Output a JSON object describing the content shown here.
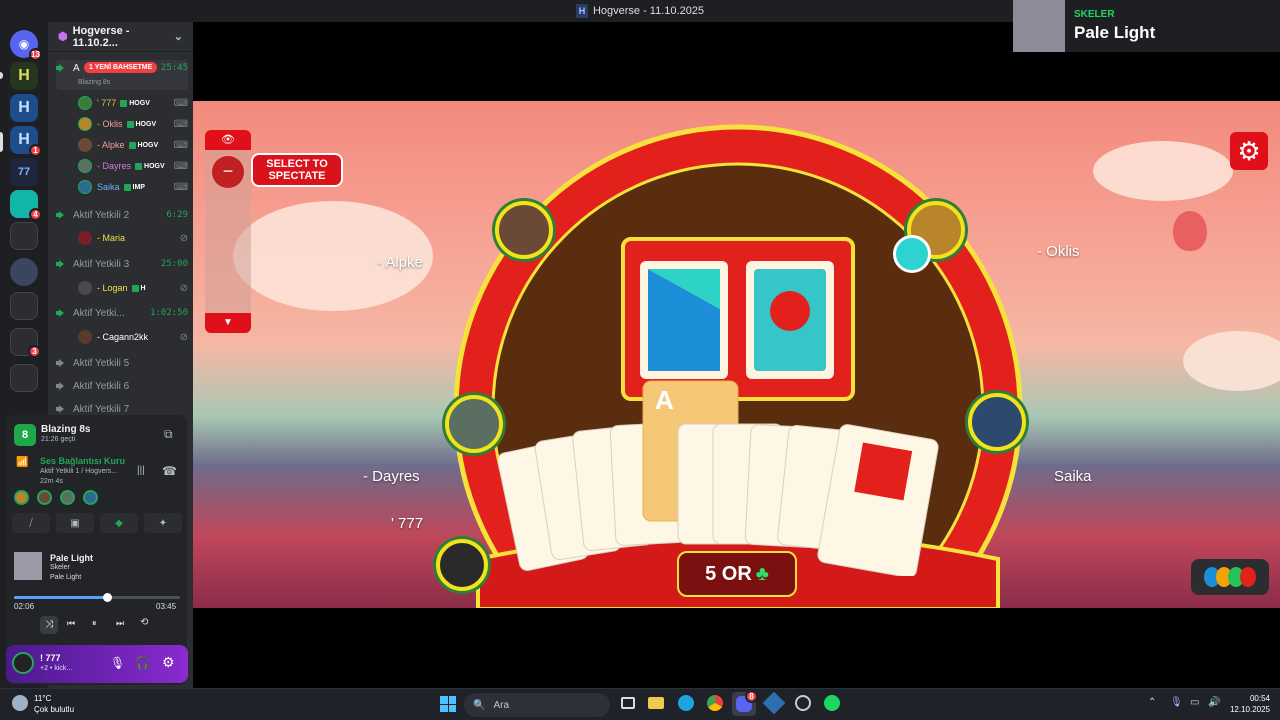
{
  "window": {
    "title": "Hogverse - 11.10.2025"
  },
  "rail": {
    "badges": [
      "13",
      "1",
      "4",
      "3"
    ]
  },
  "server": {
    "name": "Hogverse - 11.10.2...",
    "mention_badge": "1 YENİ BAHSETME",
    "channels": [
      {
        "name": "A",
        "timer": "25:45",
        "sub": "Blazing 8s",
        "members": [
          {
            "name": "' 777",
            "tag": "HOGV",
            "color": "#e0c040"
          },
          {
            "name": "- Oklis",
            "tag": "HOGV",
            "color": "#f0a0a0"
          },
          {
            "name": "- Alpke",
            "tag": "HOGV",
            "color": "#f0a0a0"
          },
          {
            "name": "- Dayres",
            "tag": "HOGV",
            "color": "#d080e0"
          },
          {
            "name": "Saika",
            "tag": "IMP",
            "color": "#6ab0ff"
          }
        ]
      },
      {
        "name": "Aktif Yetkili 2",
        "timer": "6:29",
        "members": [
          {
            "name": "- Maria",
            "tag": "",
            "color": "#f2e04a"
          }
        ]
      },
      {
        "name": "Aktif Yetkili 3",
        "timer": "25:00",
        "members": [
          {
            "name": "- Logan",
            "tag": "H",
            "color": "#f2e04a"
          }
        ]
      },
      {
        "name": "Aktif Yetki...",
        "timer": "1:02:50",
        "members": [
          {
            "name": "- Cagann2kk",
            "tag": "",
            "color": "#ffffff"
          }
        ]
      },
      {
        "name": "Aktif Yetkili 5"
      },
      {
        "name": "Aktif Yetkili 6"
      },
      {
        "name": "Aktif Yetkili 7"
      }
    ]
  },
  "activity": {
    "game": "Blazing 8s",
    "elapsed": "21:26 geçti",
    "voice_status": "Ses Bağlantısı Kuru",
    "voice_channel": "Aktif Yetkili 1 / Hogvers...",
    "voice_time": "22m 4s"
  },
  "music": {
    "title": "Pale Light",
    "artist": "Skeler",
    "album": "Pale Light",
    "current": "02:06",
    "total": "03:45",
    "progress": 0.56
  },
  "user": {
    "name": "! 777",
    "status": "+2 • kick..."
  },
  "game": {
    "spectate": "SELECT TO SPECTATE",
    "players": [
      "- Alpke",
      "- Oklis",
      "- Dayres",
      "Saika",
      "' 777"
    ],
    "call": "5 OR",
    "hand_card": "A"
  },
  "toast": {
    "artist": "SKELER",
    "title": "Pale Light"
  },
  "taskbar": {
    "weather_temp": "11°C",
    "weather_desc": "Çok bulutlu",
    "search_placeholder": "Ara",
    "time": "00:54",
    "date": "12.10.2025",
    "discord_badge": "8"
  }
}
